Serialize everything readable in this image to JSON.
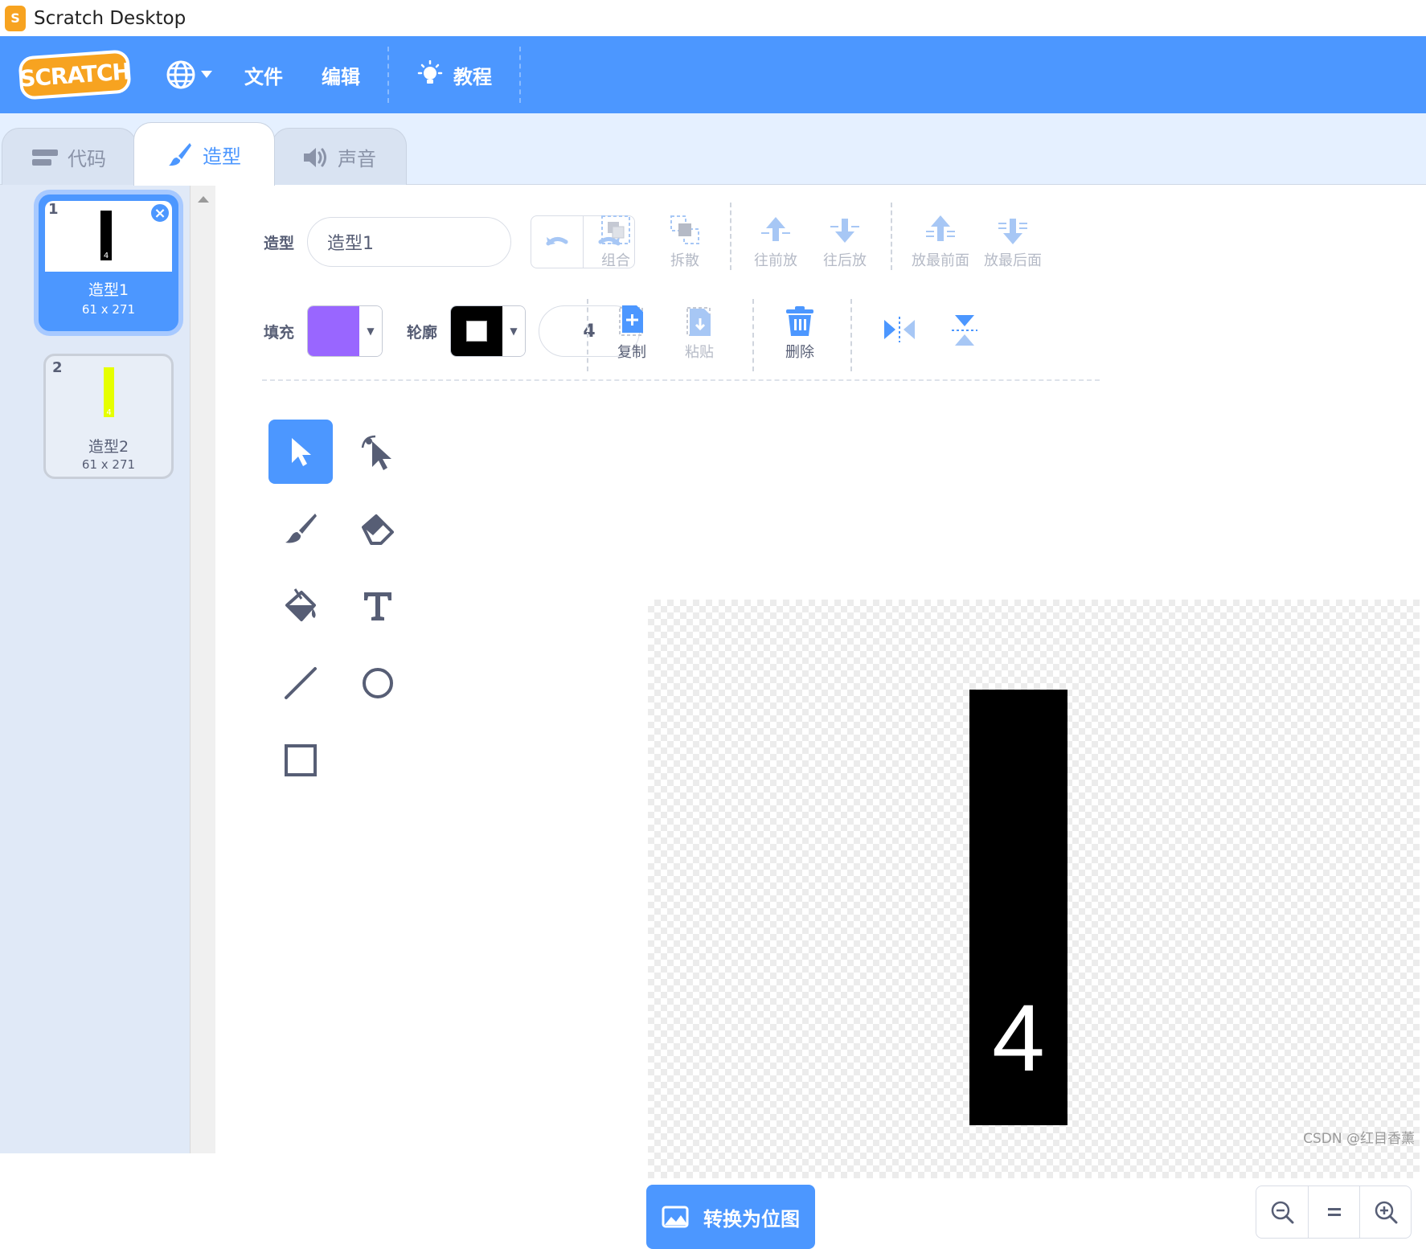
{
  "window": {
    "title": "Scratch Desktop"
  },
  "menubar": {
    "logo": "SCRATCH",
    "file": "文件",
    "edit": "编辑",
    "tutorials": "教程"
  },
  "tabs": [
    {
      "label": "代码",
      "active": false
    },
    {
      "label": "造型",
      "active": true
    },
    {
      "label": "声音",
      "active": false
    }
  ],
  "costumes": [
    {
      "number": "1",
      "name": "造型1",
      "size": "61 x 271",
      "selected": true,
      "thumb_color": "#000000",
      "thumb_digit": "4"
    },
    {
      "number": "2",
      "name": "造型2",
      "size": "61 x 271",
      "selected": false,
      "thumb_color": "#e6ff00",
      "thumb_digit": "4"
    }
  ],
  "editor": {
    "costume_label": "造型",
    "costume_name": "造型1",
    "group": "组合",
    "ungroup": "拆散",
    "forward": "往前放",
    "backward": "往后放",
    "front": "放最前面",
    "back": "放最后面",
    "fill_label": "填充",
    "fill_color": "#9966ff",
    "outline_label": "轮廓",
    "outline_color": "#000000",
    "outline_width": "4",
    "copy": "复制",
    "paste": "粘贴",
    "delete": "删除",
    "convert_bitmap": "转换为位图",
    "canvas_digit": "4"
  },
  "watermark": "CSDN @红目香薰"
}
